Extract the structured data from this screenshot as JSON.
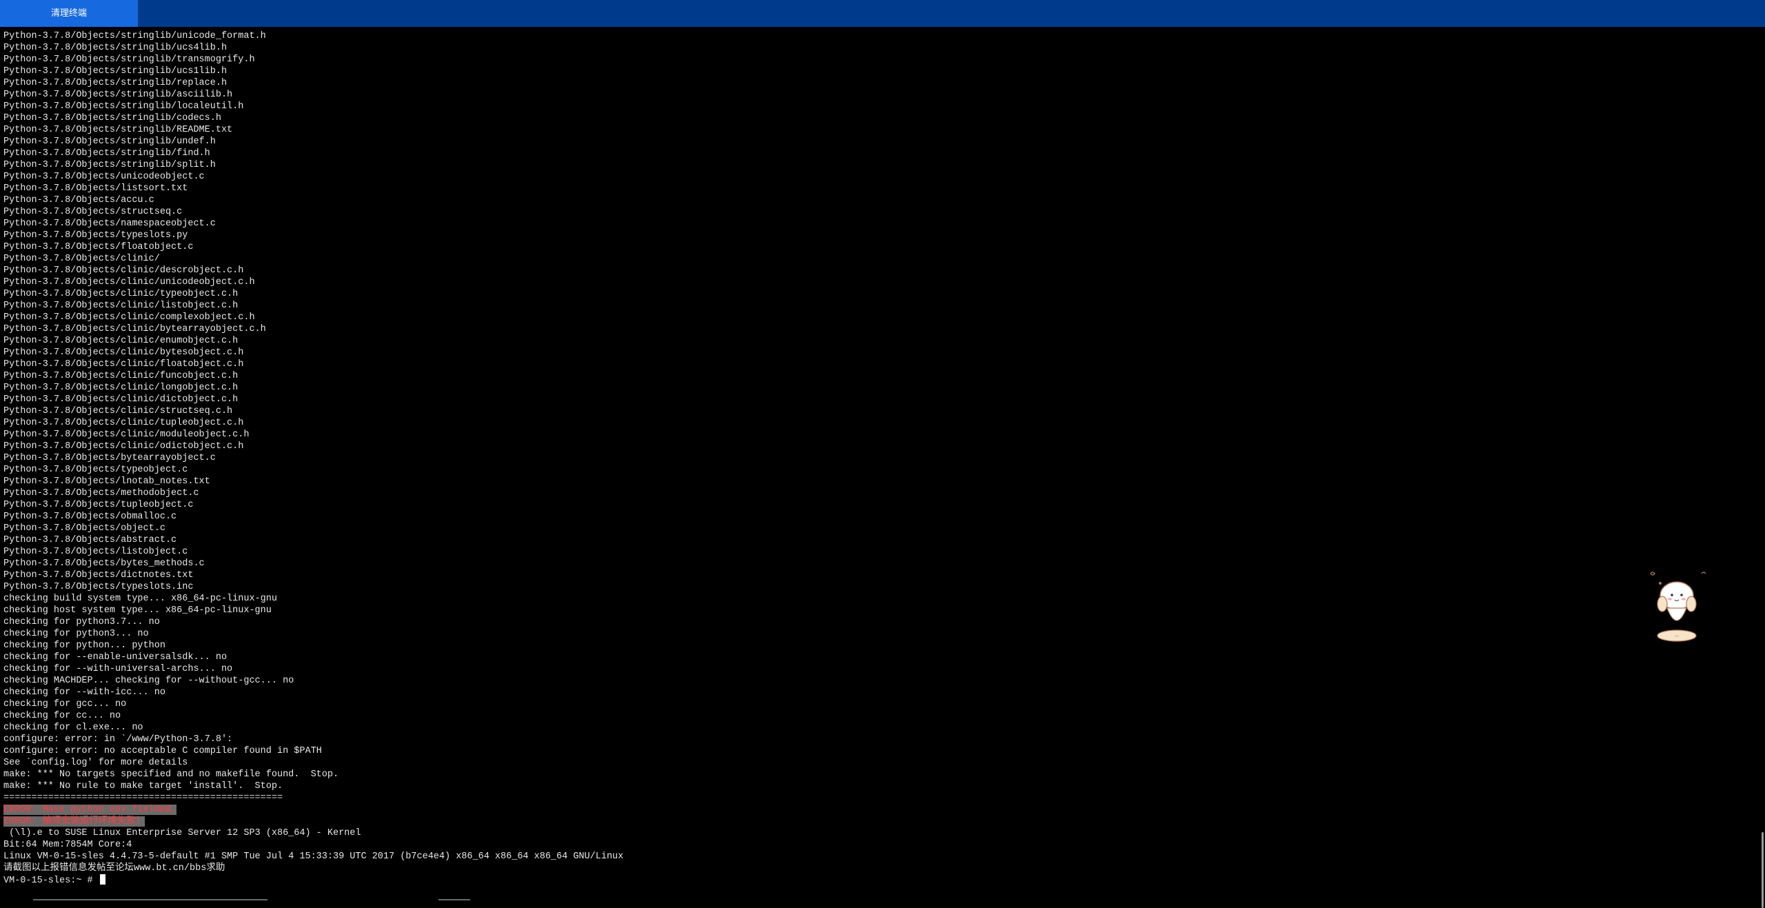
{
  "toolbar": {
    "clear_label": "清理终端"
  },
  "terminal": {
    "lines": [
      "Python-3.7.8/Objects/stringlib/unicode_format.h",
      "Python-3.7.8/Objects/stringlib/ucs4lib.h",
      "Python-3.7.8/Objects/stringlib/transmogrify.h",
      "Python-3.7.8/Objects/stringlib/ucs1lib.h",
      "Python-3.7.8/Objects/stringlib/replace.h",
      "Python-3.7.8/Objects/stringlib/asciilib.h",
      "Python-3.7.8/Objects/stringlib/localeutil.h",
      "Python-3.7.8/Objects/stringlib/codecs.h",
      "Python-3.7.8/Objects/stringlib/README.txt",
      "Python-3.7.8/Objects/stringlib/undef.h",
      "Python-3.7.8/Objects/stringlib/find.h",
      "Python-3.7.8/Objects/stringlib/split.h",
      "Python-3.7.8/Objects/unicodeobject.c",
      "Python-3.7.8/Objects/listsort.txt",
      "Python-3.7.8/Objects/accu.c",
      "Python-3.7.8/Objects/structseq.c",
      "Python-3.7.8/Objects/namespaceobject.c",
      "Python-3.7.8/Objects/typeslots.py",
      "Python-3.7.8/Objects/floatobject.c",
      "Python-3.7.8/Objects/clinic/",
      "Python-3.7.8/Objects/clinic/descrobject.c.h",
      "Python-3.7.8/Objects/clinic/unicodeobject.c.h",
      "Python-3.7.8/Objects/clinic/typeobject.c.h",
      "Python-3.7.8/Objects/clinic/listobject.c.h",
      "Python-3.7.8/Objects/clinic/complexobject.c.h",
      "Python-3.7.8/Objects/clinic/bytearrayobject.c.h",
      "Python-3.7.8/Objects/clinic/enumobject.c.h",
      "Python-3.7.8/Objects/clinic/bytesobject.c.h",
      "Python-3.7.8/Objects/clinic/floatobject.c.h",
      "Python-3.7.8/Objects/clinic/funcobject.c.h",
      "Python-3.7.8/Objects/clinic/longobject.c.h",
      "Python-3.7.8/Objects/clinic/dictobject.c.h",
      "Python-3.7.8/Objects/clinic/structseq.c.h",
      "Python-3.7.8/Objects/clinic/tupleobject.c.h",
      "Python-3.7.8/Objects/clinic/moduleobject.c.h",
      "Python-3.7.8/Objects/clinic/odictobject.c.h",
      "Python-3.7.8/Objects/bytearrayobject.c",
      "Python-3.7.8/Objects/typeobject.c",
      "Python-3.7.8/Objects/lnotab_notes.txt",
      "Python-3.7.8/Objects/methodobject.c",
      "Python-3.7.8/Objects/tupleobject.c",
      "Python-3.7.8/Objects/obmalloc.c",
      "Python-3.7.8/Objects/object.c",
      "Python-3.7.8/Objects/abstract.c",
      "Python-3.7.8/Objects/listobject.c",
      "Python-3.7.8/Objects/bytes_methods.c",
      "Python-3.7.8/Objects/dictnotes.txt",
      "Python-3.7.8/Objects/typeslots.inc",
      "checking build system type... x86_64-pc-linux-gnu",
      "checking host system type... x86_64-pc-linux-gnu",
      "checking for python3.7... no",
      "checking for python3... no",
      "checking for python... python",
      "checking for --enable-universalsdk... no",
      "checking for --with-universal-archs... no",
      "checking MACHDEP... checking for --without-gcc... no",
      "checking for --with-icc... no",
      "checking for gcc... no",
      "checking for cc... no",
      "checking for cl.exe... no",
      "configure: error: in `/www/Python-3.7.8':",
      "configure: error: no acceptable C compiler found in $PATH",
      "See `config.log' for more details",
      "make: *** No targets specified and no makefile found.  Stop.",
      "make: *** No rule to make target 'install'.  Stop."
    ],
    "separator": "==================================================",
    "error_1": "ERROR: Make python env fielded.",
    "error_2": "ERROR: 编译安装运行环境失败！",
    "sys_lines": [
      " (\\l).e to SUSE Linux Enterprise Server 12 SP3 (x86_64) - Kernel",
      "Bit:64 Mem:7854M Core:4",
      "Linux VM-0-15-sles 4.4.73-5-default #1 SMP Tue Jul 4 15:33:39 UTC 2017 (b7ce4e4) x86_64 x86_64 x86_64 GNU/Linux",
      "请截图以上报错信息发帖至论坛www.bt.cn/bbs求助"
    ],
    "prompt": "VM-0-15-sles:~ # "
  },
  "colors": {
    "topbar": "#003a8c",
    "tab_active": "#1669de",
    "terminal_bg": "#000000",
    "terminal_fg": "#e8e8e8",
    "error_fg": "#ff3b3b",
    "error_bg": "#6a6a6a"
  },
  "icons": {
    "mascot": "mascot-sticker-icon"
  }
}
